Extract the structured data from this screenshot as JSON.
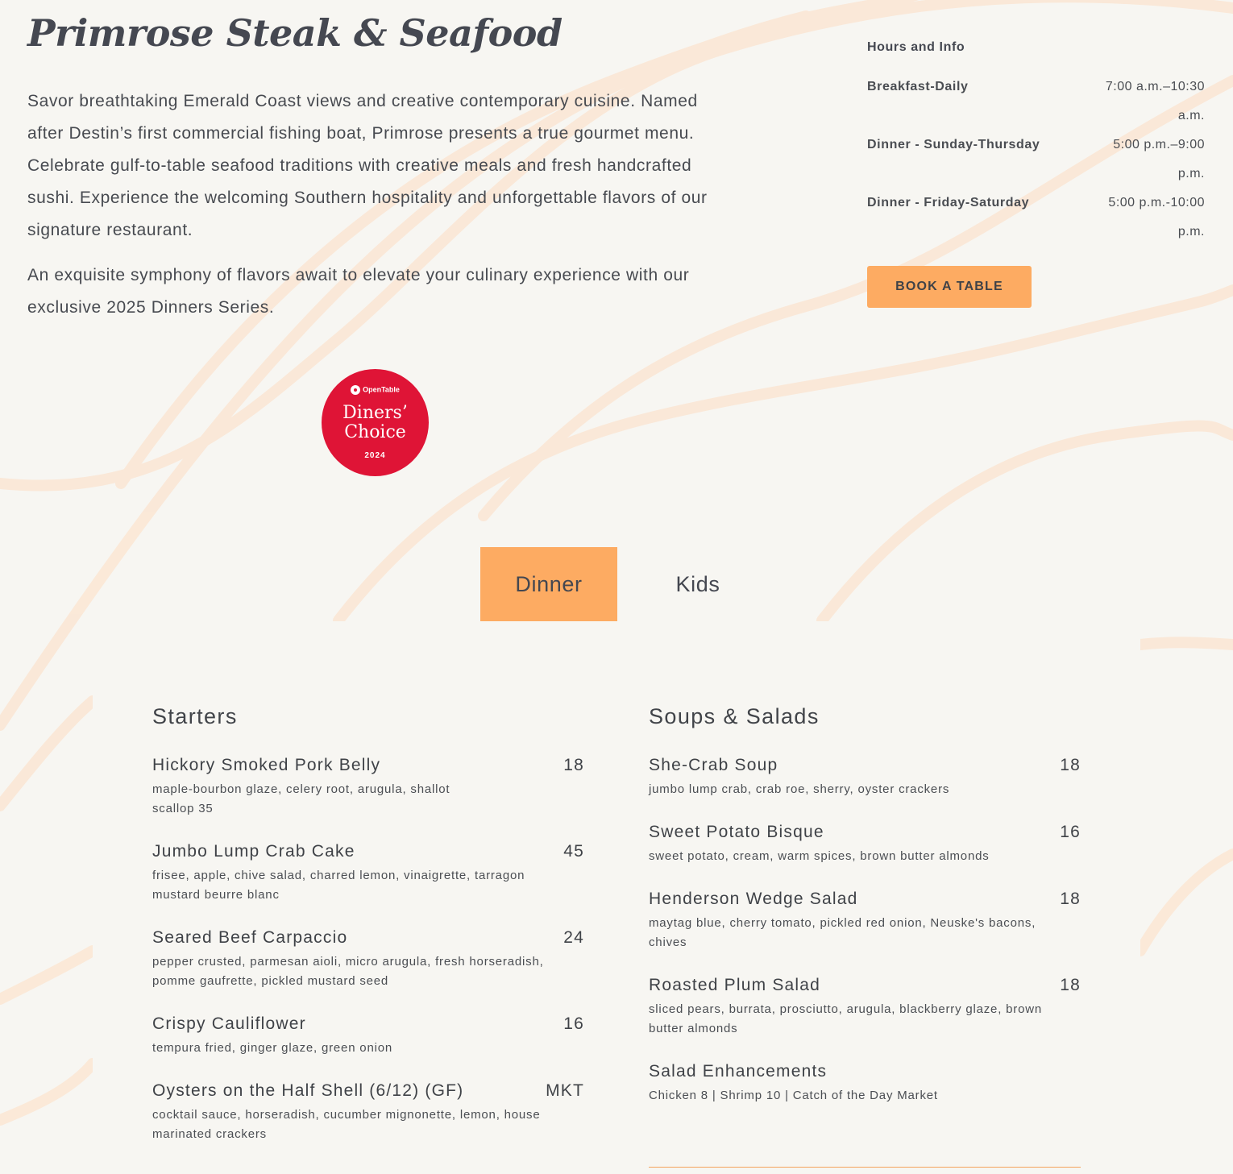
{
  "restaurant": {
    "title": "Primrose Steak & Seafood",
    "intro_paragraphs": [
      "Savor breathtaking Emerald Coast views and creative contemporary cuisine. Named after Destin’s first commercial fishing boat, Primrose presents a true gourmet menu. Celebrate gulf-to-table seafood traditions with creative meals and fresh handcrafted sushi. Experience the welcoming Southern hospitality and unforgettable flavors of our signature restaurant.",
      "An exquisite symphony of flavors await to elevate your culinary experience with our exclusive 2025 Dinners Series."
    ]
  },
  "badge": {
    "brand": "OpenTable",
    "line1": "Diners’",
    "line2": "Choice",
    "year": "2024",
    "color": "#df1436"
  },
  "hours": {
    "heading": "Hours and Info",
    "rows": [
      {
        "label": "Breakfast-Daily",
        "time_line1": "7:00 a.m.–10:30",
        "time_line2": "a.m."
      },
      {
        "label": "Dinner - Sunday-Thursday",
        "time_line1": "5:00 p.m.–9:00",
        "time_line2": "p.m."
      },
      {
        "label": "Dinner - Friday-Saturday",
        "time_line1": "5:00 p.m.-10:00",
        "time_line2": "p.m."
      }
    ],
    "book_label": "BOOK A TABLE"
  },
  "tabs": [
    {
      "label": "Dinner",
      "active": true
    },
    {
      "label": "Kids",
      "active": false
    }
  ],
  "menu": {
    "starters": {
      "heading": "Starters",
      "items": [
        {
          "name": "Hickory Smoked Pork Belly",
          "price": "18",
          "desc_line1": "maple-bourbon glaze, celery root, arugula, shallot",
          "desc_line2": "scallop 35"
        },
        {
          "name": "Jumbo Lump Crab Cake",
          "price": "45",
          "desc_line1": "frisee, apple, chive salad, charred lemon, vinaigrette, tarragon",
          "desc_line2": "mustard beurre blanc"
        },
        {
          "name": "Seared Beef Carpaccio",
          "price": "24",
          "desc_line1": "pepper crusted, parmesan aioli, micro arugula, fresh horseradish,",
          "desc_line2": "pomme gaufrette, pickled mustard seed"
        },
        {
          "name": "Crispy Cauliflower",
          "price": "16",
          "desc_line1": "tempura fried, ginger glaze, green onion",
          "desc_line2": ""
        },
        {
          "name": "Oysters on the Half Shell (6/12) (GF)",
          "price": "MKT",
          "desc_line1": "cocktail sauce, horseradish, cucumber mignonette, lemon, house",
          "desc_line2": "marinated crackers"
        }
      ]
    },
    "soups": {
      "heading": "Soups & Salads",
      "items": [
        {
          "name": "She-Crab Soup",
          "price": "18",
          "desc_line1": "jumbo lump crab, crab roe, sherry, oyster crackers",
          "desc_line2": ""
        },
        {
          "name": "Sweet Potato Bisque",
          "price": "16",
          "desc_line1": "sweet potato, cream, warm spices, brown butter almonds",
          "desc_line2": ""
        },
        {
          "name": "Henderson Wedge Salad",
          "price": "18",
          "desc_line1": "maytag blue, cherry tomato, pickled red onion, Neuske's bacons,",
          "desc_line2": "chives"
        },
        {
          "name": "Roasted Plum Salad",
          "price": "18",
          "desc_line1": "sliced pears, burrata, prosciutto, arugula, blackberry glaze, brown",
          "desc_line2": "butter almonds"
        },
        {
          "name": "Salad Enhancements",
          "price": "",
          "desc_line1": "Chicken 8 | Shrimp 10 | Catch of the Day Market",
          "desc_line2": ""
        }
      ]
    }
  },
  "colors": {
    "accent": "#fdab62",
    "background": "#f7f6f2",
    "text": "#3d3f45",
    "wave": "#fbe8d8"
  }
}
